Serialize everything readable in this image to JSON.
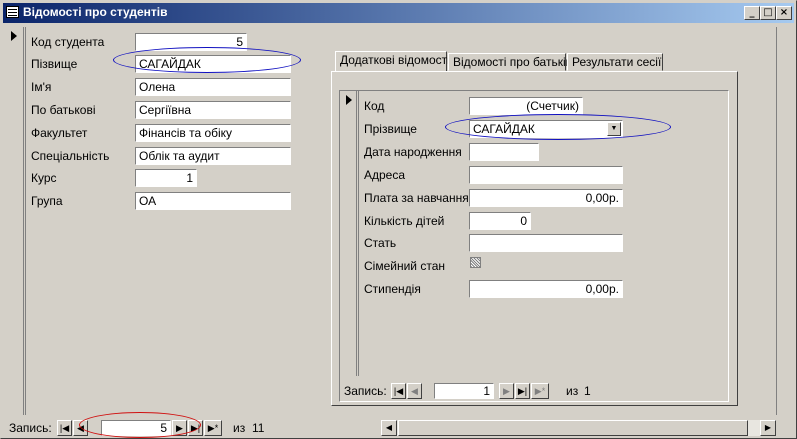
{
  "window": {
    "title": "Відомості про студентів",
    "controls": [
      "_",
      "□",
      "×"
    ]
  },
  "main_form": {
    "fields": [
      {
        "label": "Код студента",
        "value": "5"
      },
      {
        "label": "Пізвище",
        "value": "САГАЙДАК"
      },
      {
        "label": "Ім'я",
        "value": "Олена"
      },
      {
        "label": "По батькові",
        "value": "Сергіївна"
      },
      {
        "label": "Факультет",
        "value": "Фінансів та обіку"
      },
      {
        "label": "Спеціальність",
        "value": "Облік та аудит"
      },
      {
        "label": "Курс",
        "value": "1"
      },
      {
        "label": "Група",
        "value": "ОА"
      }
    ],
    "nav": {
      "label": "Запись:",
      "current": "5",
      "of_label": "из",
      "total": "11"
    }
  },
  "tabs": [
    {
      "label": "Додаткові відомості",
      "active": true
    },
    {
      "label": "Відомості про батьків",
      "active": false
    },
    {
      "label": "Результати сесії",
      "active": false
    }
  ],
  "subform": {
    "fields": [
      {
        "label": "Код",
        "value": "(Счетчик)"
      },
      {
        "label": "Прізвище",
        "value": "САГАЙДАК"
      },
      {
        "label": "Дата народження",
        "value": ""
      },
      {
        "label": "Адреса",
        "value": ""
      },
      {
        "label": "Плата за навчання",
        "value": "0,00р."
      },
      {
        "label": "Кількість дітей",
        "value": "0"
      },
      {
        "label": "Стать",
        "value": ""
      },
      {
        "label": "Сімейний стан",
        "value": ""
      },
      {
        "label": "Стипендія",
        "value": "0,00р."
      }
    ],
    "nav": {
      "label": "Запись:",
      "current": "1",
      "of_label": "из",
      "total": "1"
    }
  },
  "icons": {
    "first": "first-record-icon",
    "prev": "prev-record-icon",
    "next": "next-record-icon",
    "last": "last-record-icon",
    "new": "new-record-icon"
  },
  "colors": {
    "title_start": "#0a246a",
    "title_end": "#a6caf0",
    "annotation_blue": "#1010c0",
    "annotation_red": "#d01010"
  }
}
